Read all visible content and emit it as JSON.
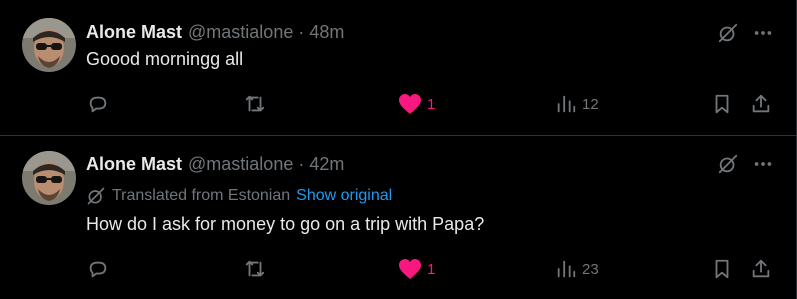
{
  "tweets": [
    {
      "author": {
        "name": "Alone Mast",
        "handle": "@mastialone"
      },
      "separator": "·",
      "time": "48m",
      "text": "Goood morningg all",
      "actions": {
        "replies": "",
        "retweets": "",
        "likes": "1",
        "views": "12"
      },
      "liked": true
    },
    {
      "author": {
        "name": "Alone Mast",
        "handle": "@mastialone"
      },
      "separator": "·",
      "time": "42m",
      "translation": {
        "label": "Translated from Estonian",
        "link": "Show original"
      },
      "text": "How do I ask for money to go on a trip with Papa?",
      "actions": {
        "replies": "",
        "retweets": "",
        "likes": "1",
        "views": "23"
      },
      "liked": true
    }
  ],
  "icons": {
    "reply": "reply-icon",
    "retweet": "retweet-icon",
    "like": "heart-icon",
    "views": "views-icon",
    "bookmark": "bookmark-icon",
    "share": "share-icon",
    "grok": "grok-icon",
    "more": "more-icon",
    "translate": "translate-icon"
  },
  "colors": {
    "background": "#000000",
    "text": "#e7e9ea",
    "secondary": "#71767b",
    "link": "#1d9bf0",
    "like": "#f91880",
    "divider": "#2f3336"
  }
}
